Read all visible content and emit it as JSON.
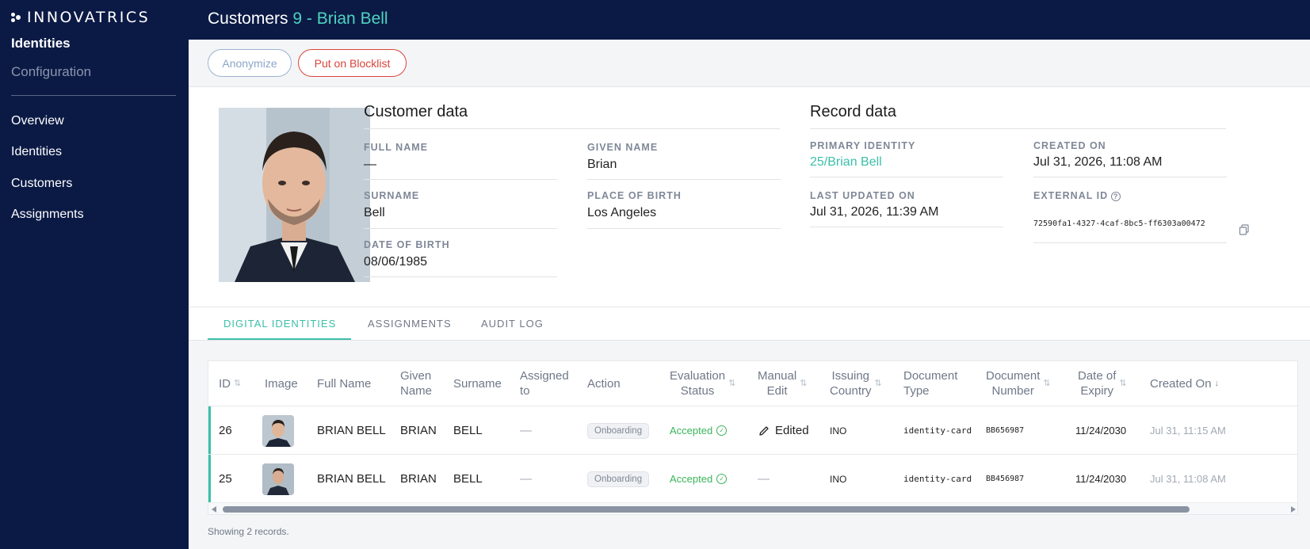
{
  "sidebar": {
    "logo_text": "INNOVATRICS",
    "active_tab": "Identities",
    "inactive_tab": "Configuration",
    "nav": [
      "Overview",
      "Identities",
      "Customers",
      "Assignments"
    ]
  },
  "header": {
    "section": "Customers",
    "record": "9 - Brian Bell"
  },
  "toolbar": {
    "anonymize_label": "Anonymize",
    "blocklist_label": "Put on Blocklist"
  },
  "customer_data": {
    "title": "Customer data",
    "full_name_label": "FULL NAME",
    "full_name": "—",
    "given_name_label": "GIVEN NAME",
    "given_name": "Brian",
    "surname_label": "SURNAME",
    "surname": "Bell",
    "place_of_birth_label": "PLACE OF BIRTH",
    "place_of_birth": "Los Angeles",
    "date_of_birth_label": "DATE OF BIRTH",
    "date_of_birth": "08/06/1985"
  },
  "record_data": {
    "title": "Record data",
    "primary_identity_label": "PRIMARY IDENTITY",
    "primary_identity": "25/Brian Bell",
    "created_on_label": "CREATED ON",
    "created_on": "Jul 31, 2026, 11:08 AM",
    "last_updated_label": "LAST UPDATED ON",
    "last_updated": "Jul 31, 2026, 11:39 AM",
    "external_id_label": "EXTERNAL ID",
    "external_id": "72590fa1-4327-4caf-8bc5-ff6303a00472"
  },
  "tabs": [
    "DIGITAL IDENTITIES",
    "ASSIGNMENTS",
    "AUDIT LOG"
  ],
  "table": {
    "headers": {
      "id": "ID",
      "image": "Image",
      "full_name": "Full Name",
      "given_name_1": "Given",
      "given_name_2": "Name",
      "surname": "Surname",
      "assigned_1": "Assigned",
      "assigned_2": "to",
      "action": "Action",
      "eval_1": "Evaluation",
      "eval_2": "Status",
      "manual_1": "Manual",
      "manual_2": "Edit",
      "issuing_1": "Issuing",
      "issuing_2": "Country",
      "doctype_1": "Document",
      "doctype_2": "Type",
      "docnum_1": "Document",
      "docnum_2": "Number",
      "expiry_1": "Date of",
      "expiry_2": "Expiry",
      "created_on": "Created On"
    },
    "rows": [
      {
        "id": "26",
        "full_name": "BRIAN BELL",
        "given_name": "BRIAN",
        "surname": "BELL",
        "assigned_to": "—",
        "action": "Onboarding",
        "evaluation": "Accepted",
        "manual_edit": "Edited",
        "issuing_country": "INO",
        "document_type": "identity-card",
        "document_number": "BB656987",
        "date_of_expiry": "11/24/2030",
        "created_on": "Jul 31, 11:15 AM"
      },
      {
        "id": "25",
        "full_name": "BRIAN BELL",
        "given_name": "BRIAN",
        "surname": "BELL",
        "assigned_to": "—",
        "action": "Onboarding",
        "evaluation": "Accepted",
        "manual_edit": "—",
        "issuing_country": "INO",
        "document_type": "identity-card",
        "document_number": "BB456987",
        "date_of_expiry": "11/24/2030",
        "created_on": "Jul 31, 11:08 AM"
      }
    ]
  },
  "footer": {
    "records_text": "Showing 2 records."
  }
}
